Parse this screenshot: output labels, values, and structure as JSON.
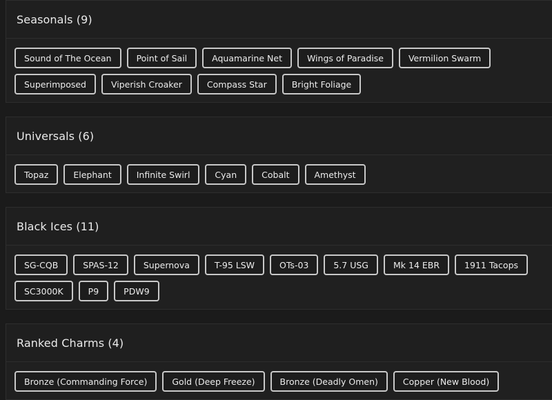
{
  "sections": [
    {
      "title": "Seasonals (9)",
      "items": [
        "Sound of The Ocean",
        "Point of Sail",
        "Aquamarine Net",
        "Wings of Paradise",
        "Vermilion Swarm",
        "Superimposed",
        "Viperish Croaker",
        "Compass Star",
        "Bright Foliage"
      ]
    },
    {
      "title": "Universals (6)",
      "items": [
        "Topaz",
        "Elephant",
        "Infinite Swirl",
        "Cyan",
        "Cobalt",
        "Amethyst"
      ]
    },
    {
      "title": "Black Ices (11)",
      "items": [
        "SG-CQB",
        "SPAS-12",
        "Supernova",
        "T-95 LSW",
        "OTs-03",
        "5.7 USG",
        "Mk 14 EBR",
        "1911 Tacops",
        "SC3000K",
        "P9",
        "PDW9"
      ]
    },
    {
      "title": "Ranked Charms (4)",
      "items": [
        "Bronze (Commanding Force)",
        "Gold (Deep Freeze)",
        "Bronze (Deadly Omen)",
        "Copper (New Blood)"
      ]
    }
  ]
}
